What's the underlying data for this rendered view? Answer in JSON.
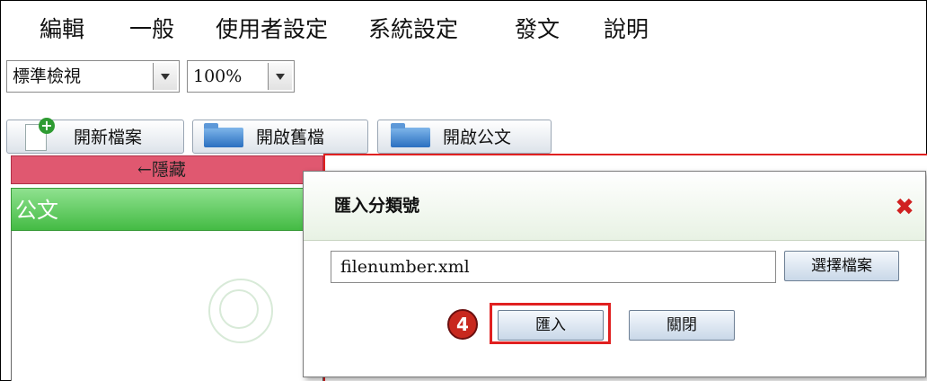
{
  "menu": {
    "items": [
      "編輯",
      "一般",
      "使用者設定",
      "系統設定",
      "發文",
      "說明"
    ]
  },
  "view": {
    "mode_value": "標準檢視",
    "zoom_value": "100%"
  },
  "toolbar": {
    "new_file": "開新檔案",
    "open_old": "開啟舊檔",
    "open_doc": "開啟公文"
  },
  "left_panel": {
    "hide_label": "←隱藏",
    "header": "公文"
  },
  "dialog": {
    "title": "匯入分類號",
    "file_value": "filenumber.xml",
    "choose_button": "選擇檔案",
    "import_button": "匯入",
    "close_button": "關閉",
    "step_badge": "4"
  },
  "colors": {
    "hide_bar": "#e05870",
    "header_green": "#44bb44",
    "highlight_red": "#e02020",
    "badge_red": "#c8281e",
    "close_x": "#d02020"
  },
  "icons": [
    "new-file-icon",
    "open-folder-icon",
    "document-folder-icon",
    "close-icon",
    "dropdown-arrow-icon"
  ]
}
